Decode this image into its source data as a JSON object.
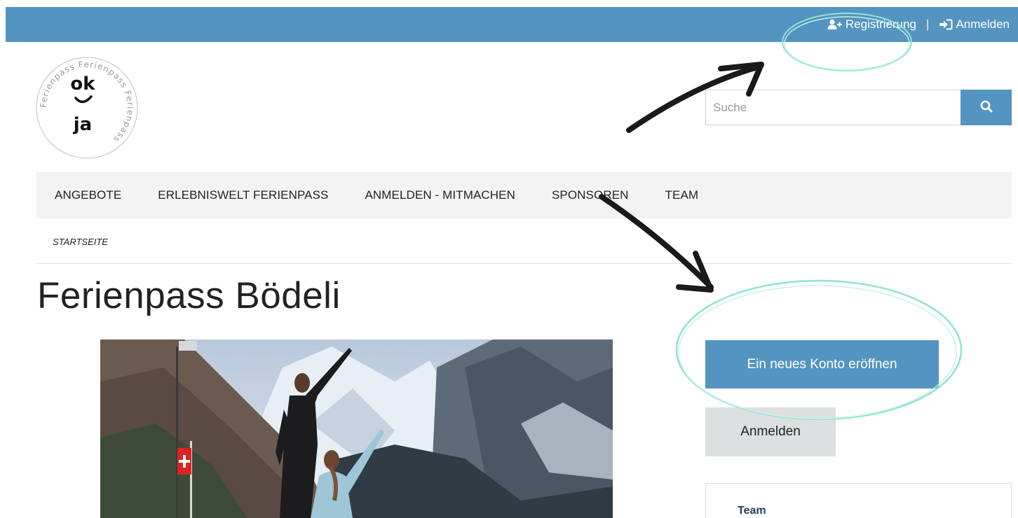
{
  "topbar": {
    "register_label": "Registrierung",
    "separator": "|",
    "login_label": "Anmelden",
    "register_icon": "user-plus-icon",
    "login_icon": "sign-in-icon"
  },
  "logo": {
    "ring_text": "Ferienpass Ferienpass Ferienpass",
    "line1": "ok",
    "line2": "ja"
  },
  "search": {
    "placeholder": "Suche",
    "icon": "search-icon"
  },
  "nav": {
    "items": [
      {
        "label": "ANGEBOTE"
      },
      {
        "label": "ERLEBNISWELT FERIENPASS"
      },
      {
        "label": "ANMELDEN - MITMACHEN"
      },
      {
        "label": "SPONSOREN"
      },
      {
        "label": "TEAM"
      }
    ]
  },
  "breadcrumb": "STARTSEITE",
  "page_title": "Ferienpass Bödeli",
  "sidebar": {
    "new_account_label": "Ein neues Konto eröffnen",
    "login_label": "Anmelden",
    "team_title": "Team"
  },
  "colors": {
    "brand_blue": "#5494c0",
    "annotation_circle": "#8fe3d6",
    "annotation_arrow": "#1a1a1a"
  }
}
